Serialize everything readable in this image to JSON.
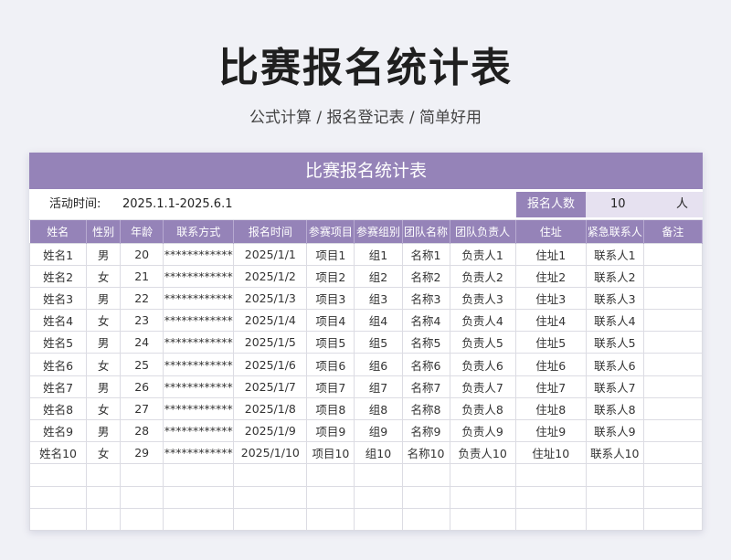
{
  "page": {
    "title": "比赛报名统计表",
    "subtitle": "公式计算 / 报名登记表 / 简单好用"
  },
  "sheet": {
    "header": "比赛报名统计表",
    "activity_label": "活动时间:",
    "activity_value": "2025.1.1-2025.6.1",
    "count_label": "报名人数",
    "count_value": "10",
    "count_unit": "人",
    "columns": [
      "姓名",
      "性别",
      "年龄",
      "联系方式",
      "报名时间",
      "参赛项目",
      "参赛组别",
      "团队名称",
      "团队负责人",
      "住址",
      "紧急联系人",
      "备注"
    ],
    "rows": [
      [
        "姓名1",
        "男",
        "20",
        "************",
        "2025/1/1",
        "项目1",
        "组1",
        "名称1",
        "负责人1",
        "住址1",
        "联系人1",
        ""
      ],
      [
        "姓名2",
        "女",
        "21",
        "************",
        "2025/1/2",
        "项目2",
        "组2",
        "名称2",
        "负责人2",
        "住址2",
        "联系人2",
        ""
      ],
      [
        "姓名3",
        "男",
        "22",
        "************",
        "2025/1/3",
        "项目3",
        "组3",
        "名称3",
        "负责人3",
        "住址3",
        "联系人3",
        ""
      ],
      [
        "姓名4",
        "女",
        "23",
        "************",
        "2025/1/4",
        "项目4",
        "组4",
        "名称4",
        "负责人4",
        "住址4",
        "联系人4",
        ""
      ],
      [
        "姓名5",
        "男",
        "24",
        "************",
        "2025/1/5",
        "项目5",
        "组5",
        "名称5",
        "负责人5",
        "住址5",
        "联系人5",
        ""
      ],
      [
        "姓名6",
        "女",
        "25",
        "************",
        "2025/1/6",
        "项目6",
        "组6",
        "名称6",
        "负责人6",
        "住址6",
        "联系人6",
        ""
      ],
      [
        "姓名7",
        "男",
        "26",
        "************",
        "2025/1/7",
        "项目7",
        "组7",
        "名称7",
        "负责人7",
        "住址7",
        "联系人7",
        ""
      ],
      [
        "姓名8",
        "女",
        "27",
        "************",
        "2025/1/8",
        "项目8",
        "组8",
        "名称8",
        "负责人8",
        "住址8",
        "联系人8",
        ""
      ],
      [
        "姓名9",
        "男",
        "28",
        "************",
        "2025/1/9",
        "项目9",
        "组9",
        "名称9",
        "负责人9",
        "住址9",
        "联系人9",
        ""
      ],
      [
        "姓名10",
        "女",
        "29",
        "************",
        "2025/1/10",
        "项目10",
        "组10",
        "名称10",
        "负责人10",
        "住址10",
        "联系人10",
        ""
      ],
      [
        "",
        "",
        "",
        "",
        "",
        "",
        "",
        "",
        "",
        "",
        "",
        ""
      ],
      [
        "",
        "",
        "",
        "",
        "",
        "",
        "",
        "",
        "",
        "",
        "",
        ""
      ],
      [
        "",
        "",
        "",
        "",
        "",
        "",
        "",
        "",
        "",
        "",
        "",
        ""
      ]
    ]
  },
  "colors": {
    "accent": "#9583b8",
    "accent_light": "#e6e1f0",
    "background": "#f0f1f6"
  }
}
